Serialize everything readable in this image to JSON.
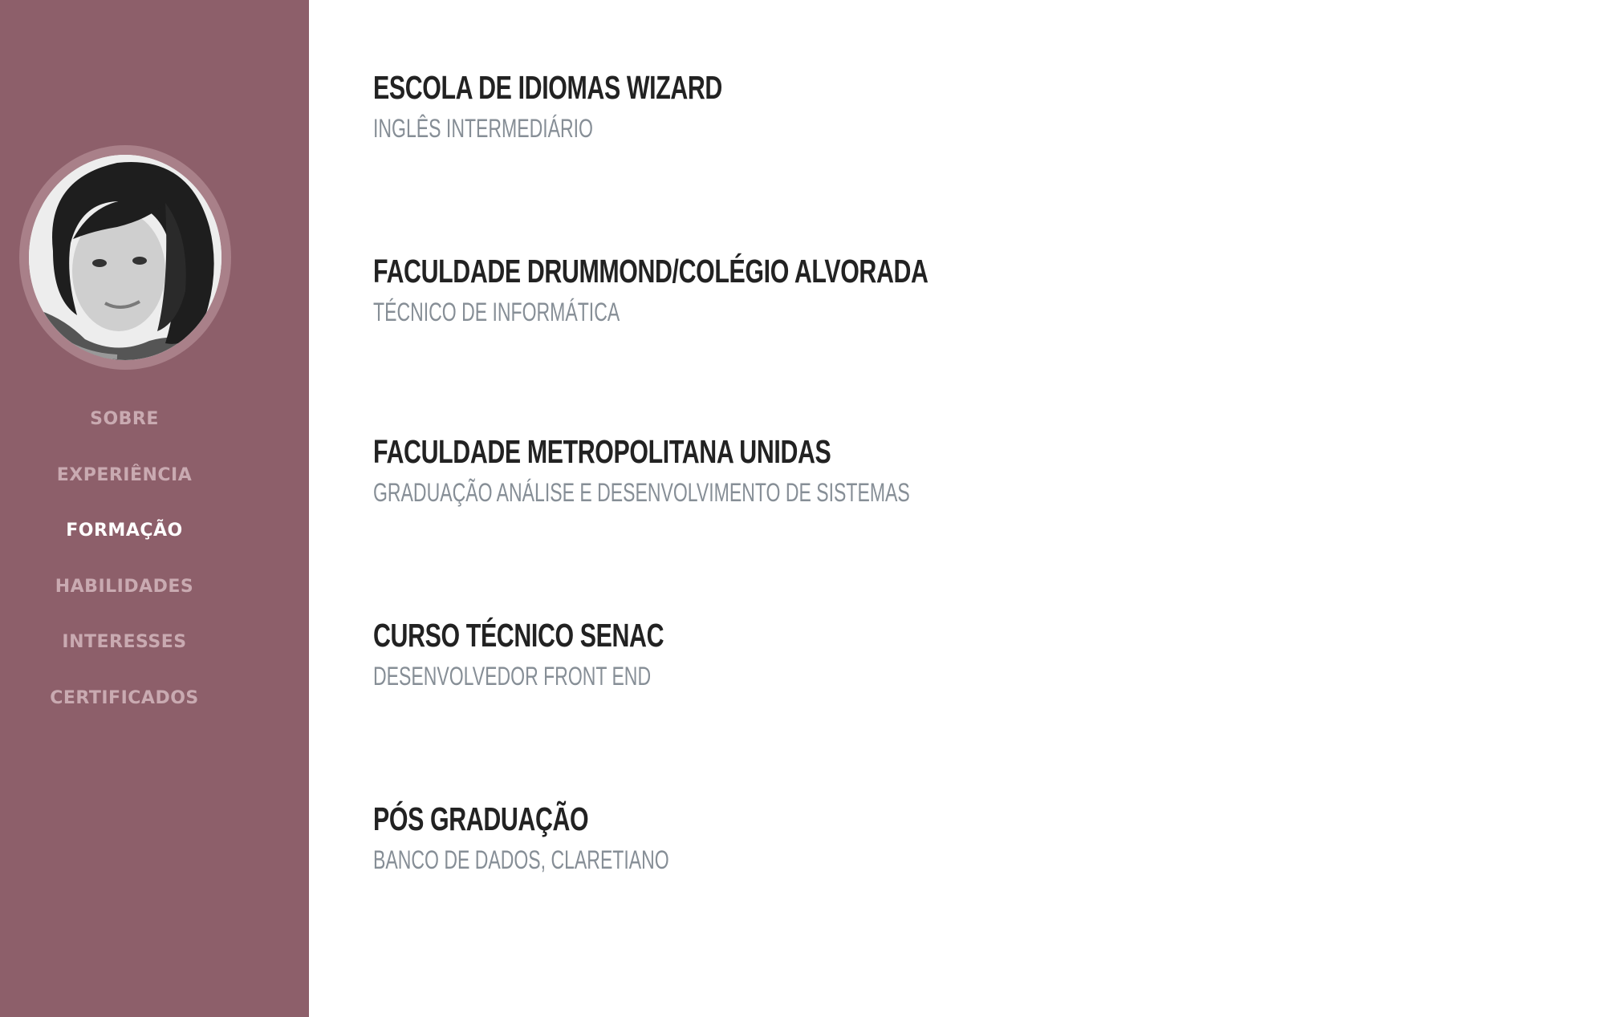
{
  "theme": {
    "sidebar_bg": "#8d5f6a",
    "nav_color": "#c9aab1",
    "nav_active_color": "#ffffff",
    "title_color": "#222222",
    "subtitle_color": "#868e96"
  },
  "sidebar": {
    "avatar": "profile-photo",
    "nav": [
      {
        "label": "SOBRE",
        "active": false
      },
      {
        "label": "EXPERIÊNCIA",
        "active": false
      },
      {
        "label": "FORMAÇÃO",
        "active": true
      },
      {
        "label": "HABILIDADES",
        "active": false
      },
      {
        "label": "INTERESSES",
        "active": false
      },
      {
        "label": "CERTIFICADOS",
        "active": false
      }
    ]
  },
  "education": [
    {
      "title": "ESCOLA DE IDIOMAS WIZARD",
      "subtitle": "INGLÊS INTERMEDIÁRIO"
    },
    {
      "title": "FACULDADE DRUMMOND/COLÉGIO ALVORADA",
      "subtitle": "TÉCNICO DE INFORMÁTICA"
    },
    {
      "title": "FACULDADE METROPOLITANA UNIDAS",
      "subtitle": "GRADUAÇÃO ANÁLISE E DESENVOLVIMENTO DE SISTEMAS"
    },
    {
      "title": "CURSO TÉCNICO SENAC",
      "subtitle": "DESENVOLVEDOR FRONT END"
    },
    {
      "title": "PÓS GRADUAÇÃO",
      "subtitle": "BANCO DE DADOS, CLARETIANO"
    }
  ]
}
